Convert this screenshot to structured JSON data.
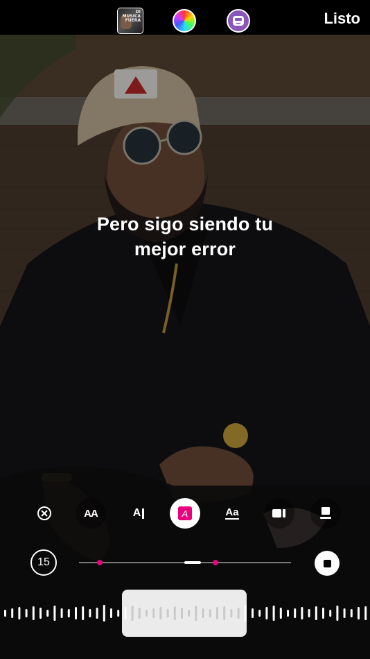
{
  "header": {
    "album_cover_text": "DI MUSICA FUERA",
    "done_label": "Listo",
    "icons": [
      "album-cover",
      "color-wheel-icon",
      "sticker-face-icon"
    ]
  },
  "caption": {
    "line1": "Pero sigo siendo tu",
    "line2": "mejor error"
  },
  "toolbar": {
    "items": [
      {
        "name": "remove-icon",
        "label": ""
      },
      {
        "name": "font-size-icon",
        "label": "AA"
      },
      {
        "name": "typewriter-effect-icon",
        "label": "A"
      },
      {
        "name": "highlight-style-icon",
        "label": "A"
      },
      {
        "name": "font-style-icon",
        "label": "Aa"
      },
      {
        "name": "video-placement-icon",
        "label": ""
      },
      {
        "name": "layout-icon",
        "label": ""
      }
    ],
    "selected": "highlight-style-icon"
  },
  "timeline": {
    "duration": "15",
    "progress_fraction": 0.52,
    "marker_fractions": [
      0.1,
      0.64
    ]
  },
  "colors": {
    "accent": "#e8007c",
    "sticker_bg": "#8a56b8"
  }
}
